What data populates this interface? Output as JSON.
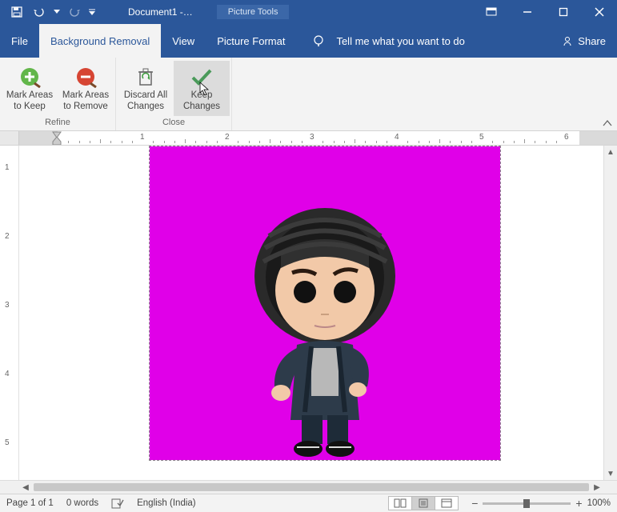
{
  "titlebar": {
    "doc_title": "Document1  -…",
    "context_tab": "Picture Tools"
  },
  "tabs": {
    "file": "File",
    "bg_removal": "Background Removal",
    "view": "View",
    "picture_format": "Picture Format",
    "tell_me": "Tell me what you want to do",
    "share": "Share"
  },
  "ribbon": {
    "mark_keep": "Mark Areas to Keep",
    "mark_remove": "Mark Areas to Remove",
    "discard": "Discard All Changes",
    "keep": "Keep Changes",
    "group_refine": "Refine",
    "group_close": "Close"
  },
  "ruler": {
    "nums": [
      "1",
      "2",
      "3",
      "4",
      "5",
      "6"
    ]
  },
  "status": {
    "page": "Page 1 of 1",
    "words": "0 words",
    "lang": "English (India)",
    "zoom": "100%"
  }
}
